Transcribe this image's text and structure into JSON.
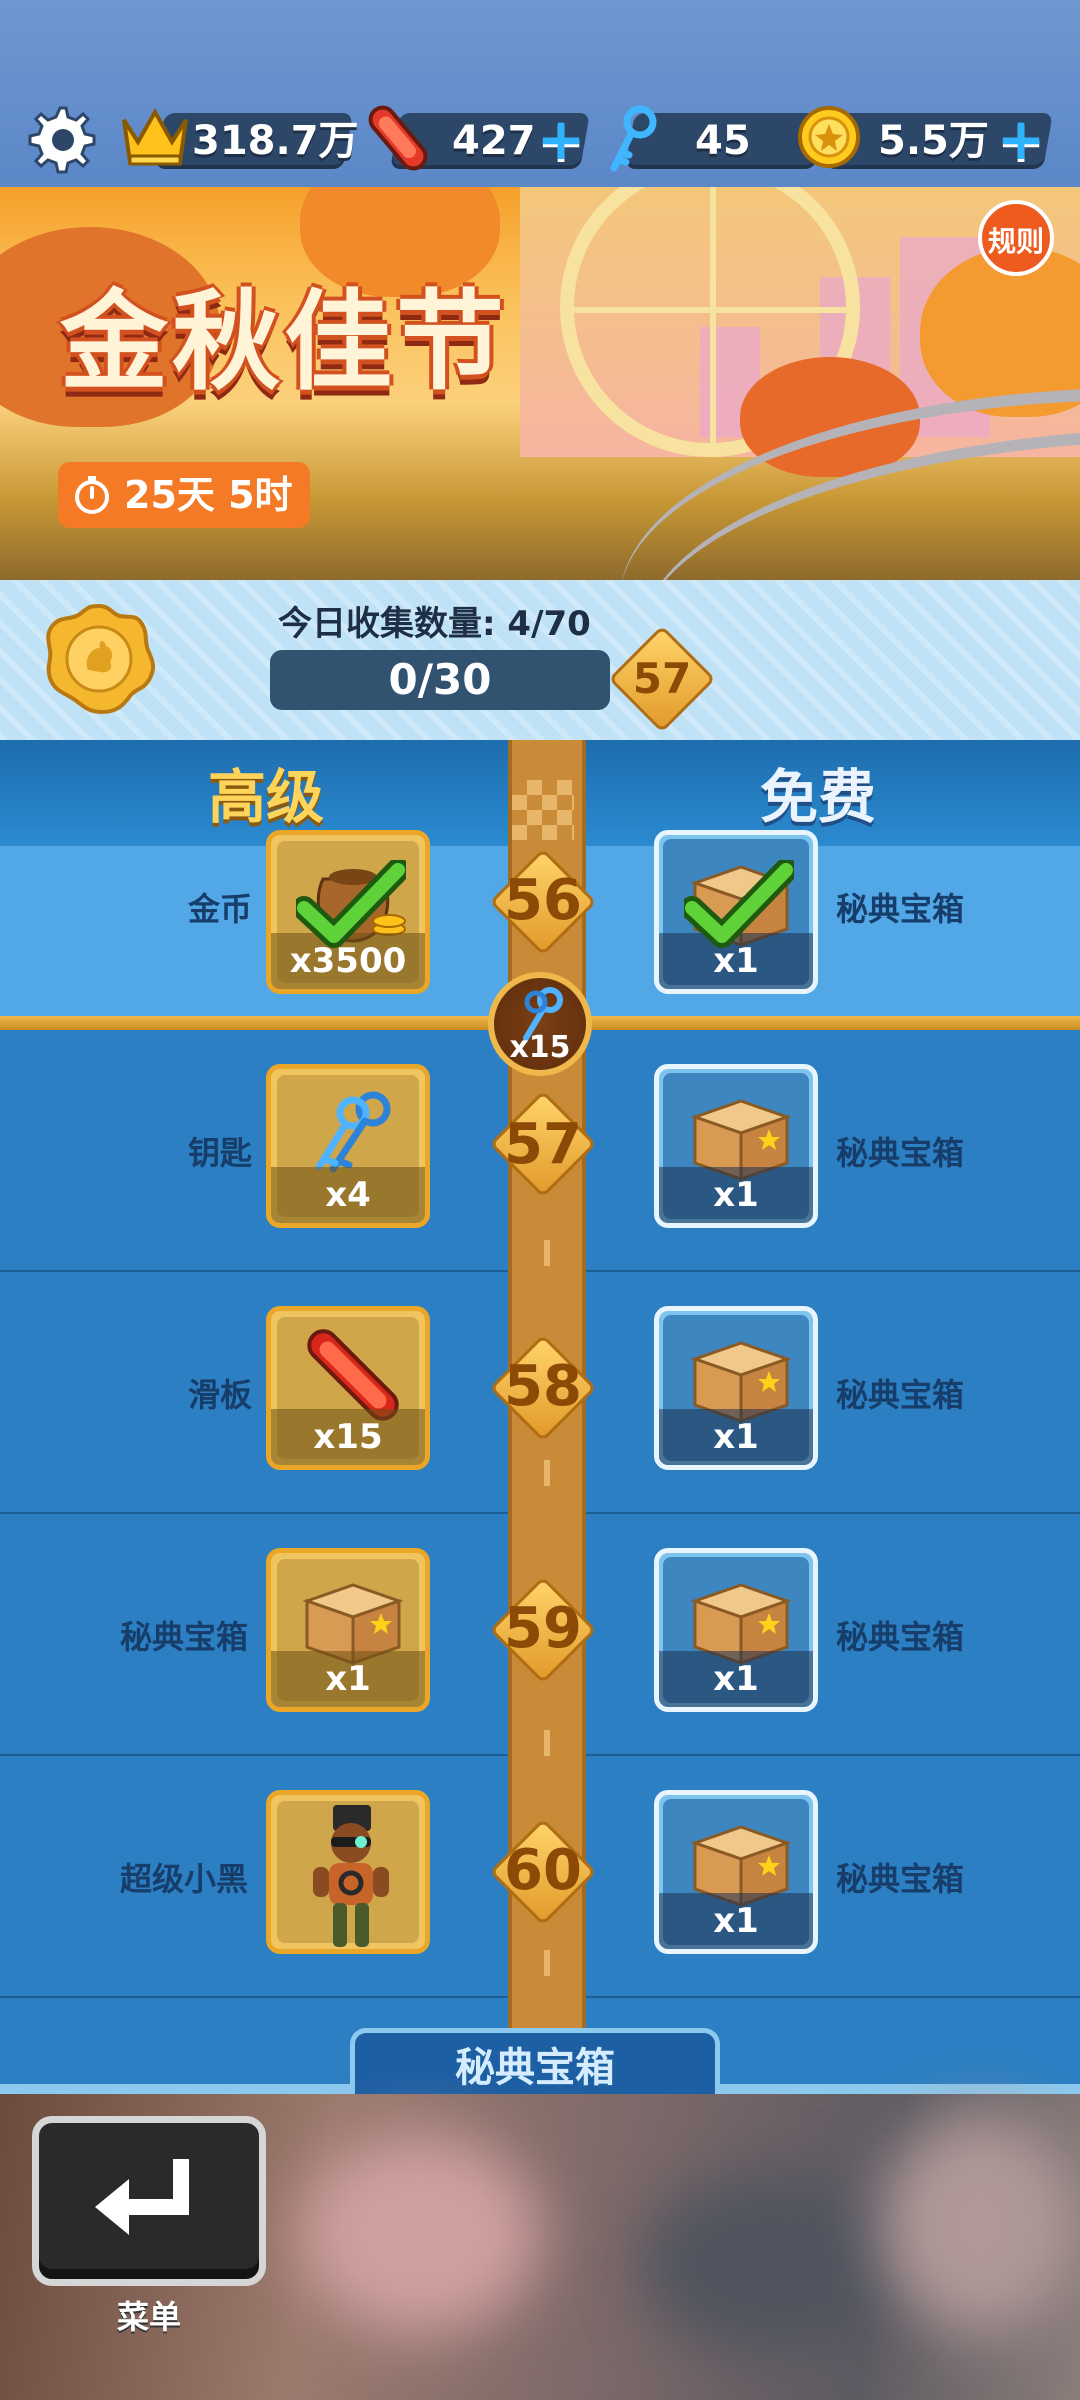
{
  "topbar": {
    "trophy_value": "318.7万",
    "hoverboards_value": "427",
    "keys_value": "45",
    "coins_value": "5.5万",
    "plus_symbol": "+"
  },
  "banner": {
    "title": "金秋佳节",
    "timer": "25天 5时",
    "rules_label": "规则"
  },
  "collection": {
    "daily_label": "今日收集数量: 4/70",
    "progress_text": "0/30",
    "current_level": "57"
  },
  "columns": {
    "premium_title": "高级",
    "free_title": "免费"
  },
  "rows": [
    {
      "level": "56",
      "premium_label": "金币",
      "premium_qty": "x3500",
      "premium_icon": "coin-bag-icon",
      "premium_claimed": true,
      "free_label": "秘典宝箱",
      "free_qty": "x1",
      "free_icon": "mystery-box-icon",
      "free_claimed": true
    },
    {
      "level": "57",
      "premium_label": "钥匙",
      "premium_qty": "x4",
      "premium_icon": "keys-icon",
      "free_label": "秘典宝箱",
      "free_qty": "x1",
      "free_icon": "mystery-box-icon"
    },
    {
      "level": "58",
      "premium_label": "滑板",
      "premium_qty": "x15",
      "premium_icon": "hoverboard-icon",
      "free_label": "秘典宝箱",
      "free_qty": "x1",
      "free_icon": "mystery-box-icon"
    },
    {
      "level": "59",
      "premium_label": "秘典宝箱",
      "premium_qty": "x1",
      "premium_icon": "mystery-box-icon",
      "free_label": "秘典宝箱",
      "free_qty": "x1",
      "free_icon": "mystery-box-icon"
    },
    {
      "level": "60",
      "premium_label": "超级小黑",
      "premium_qty": "",
      "premium_icon": "character-icon",
      "free_label": "秘典宝箱",
      "free_qty": "x1",
      "free_icon": "mystery-box-icon"
    }
  ],
  "milestone": {
    "qty": "x15",
    "icon": "keys-icon"
  },
  "bottom_tab": {
    "label": "秘典宝箱"
  },
  "footer": {
    "menu_label": "菜单"
  },
  "colors": {
    "premium_gold": "#f0c45e",
    "free_blue": "#3d86c0",
    "accent_orange": "#f57a26",
    "track_brown": "#c98b37"
  }
}
